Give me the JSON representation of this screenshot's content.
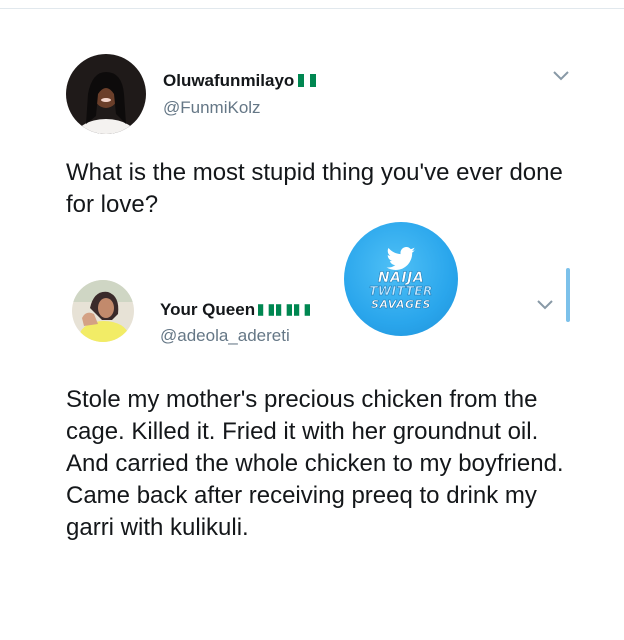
{
  "tweet1": {
    "display_name": "Oluwafunmilayo",
    "handle": "@FunmiKolz",
    "text": "What is the most stupid thing you've ever done for love?",
    "flag": "nigeria-flag"
  },
  "tweet2": {
    "display_name": "Your Queen",
    "handle": "@adeola_adereti",
    "text": "Stole my mother's precious chicken from the cage. Killed it. Fried it with her groundnut oil. And carried the whole chicken to my boyfriend. Came back after receiving preeq to drink my garri with kulikuli.",
    "flags": [
      "nigeria-flag",
      "nigeria-flag",
      "nigeria-flag"
    ]
  },
  "watermark": {
    "line1": "NAIJA",
    "line2": "TWITTER",
    "line3": "SAVAGES",
    "icon": "twitter-bird-icon"
  },
  "colors": {
    "text": "#14171a",
    "handle": "#657786",
    "badge": "#2aa6ec",
    "flag_green": "#008751",
    "scrollbar": "#7cc1ea"
  }
}
